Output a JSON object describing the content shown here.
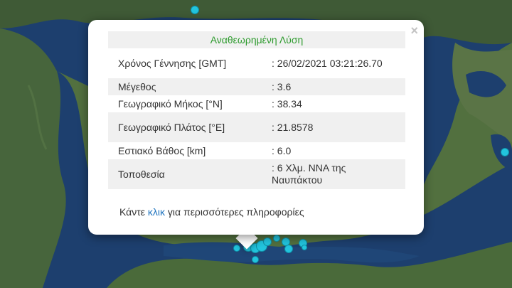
{
  "popup": {
    "title": "Αναθεωρημένη Λύση",
    "rows": [
      {
        "label": "Χρόνος Γέννησης [GMT]",
        "value": ": 26/02/2021 03:21:26.70"
      },
      {
        "label": "Μέγεθος",
        "value": ": 3.6"
      },
      {
        "label": "Γεωγραφικό Μήκος [°N]",
        "value": ": 38.34"
      },
      {
        "label": "Γεωγραφικό Πλάτος [°E]",
        "value": ": 21.8578"
      },
      {
        "label": "Εστιακό Βάθος [km]",
        "value": ": 6.0"
      },
      {
        "label": "Τοποθεσία",
        "value": ": 6 Χλμ. ΝΝΑ της Ναυπάκτου"
      }
    ],
    "footer_prefix": "Κάντε ",
    "footer_link": "κλικ",
    "footer_suffix": " για περισσότερες πληροφορίες",
    "close_label": "×"
  },
  "colors": {
    "title_green": "#2e9b2e",
    "link_blue": "#1e73be",
    "quake_marker": "#22c4dd",
    "sea": "#1d3f6e",
    "land": "#3f5a36"
  },
  "icons": [
    "close-icon",
    "earthquake-marker"
  ]
}
